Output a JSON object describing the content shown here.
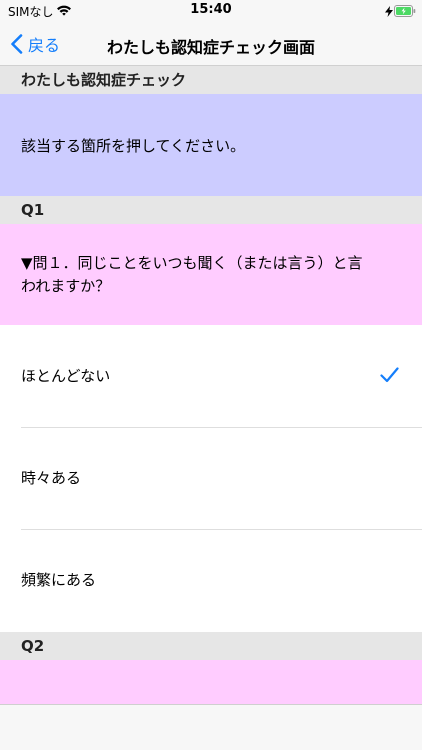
{
  "status_bar": {
    "carrier": "SIMなし",
    "time": "15:40",
    "wifi_icon": "wifi-icon",
    "battery_icon": "battery-charging-icon"
  },
  "nav": {
    "back_label": "戻る",
    "title": "わたしも認知症チェック画面"
  },
  "header_section": {
    "title": "わたしも認知症チェック",
    "instruction": "該当する箇所を押してください。"
  },
  "q1": {
    "label": "Q1",
    "question_line1": "▼問１．同じことをいつも聞く（または言う）と言",
    "question_line2": "われますか？",
    "answers": [
      {
        "label": "ほとんどない",
        "selected": true
      },
      {
        "label": "時々ある",
        "selected": false
      },
      {
        "label": "頻繁にある",
        "selected": false
      }
    ]
  },
  "q2": {
    "label": "Q2"
  },
  "colors": {
    "accent": "#147efb",
    "info_bg": "#ccccff",
    "question_bg": "#ffccff",
    "section_bg": "#e6e6e6",
    "battery": "#4cd964"
  }
}
